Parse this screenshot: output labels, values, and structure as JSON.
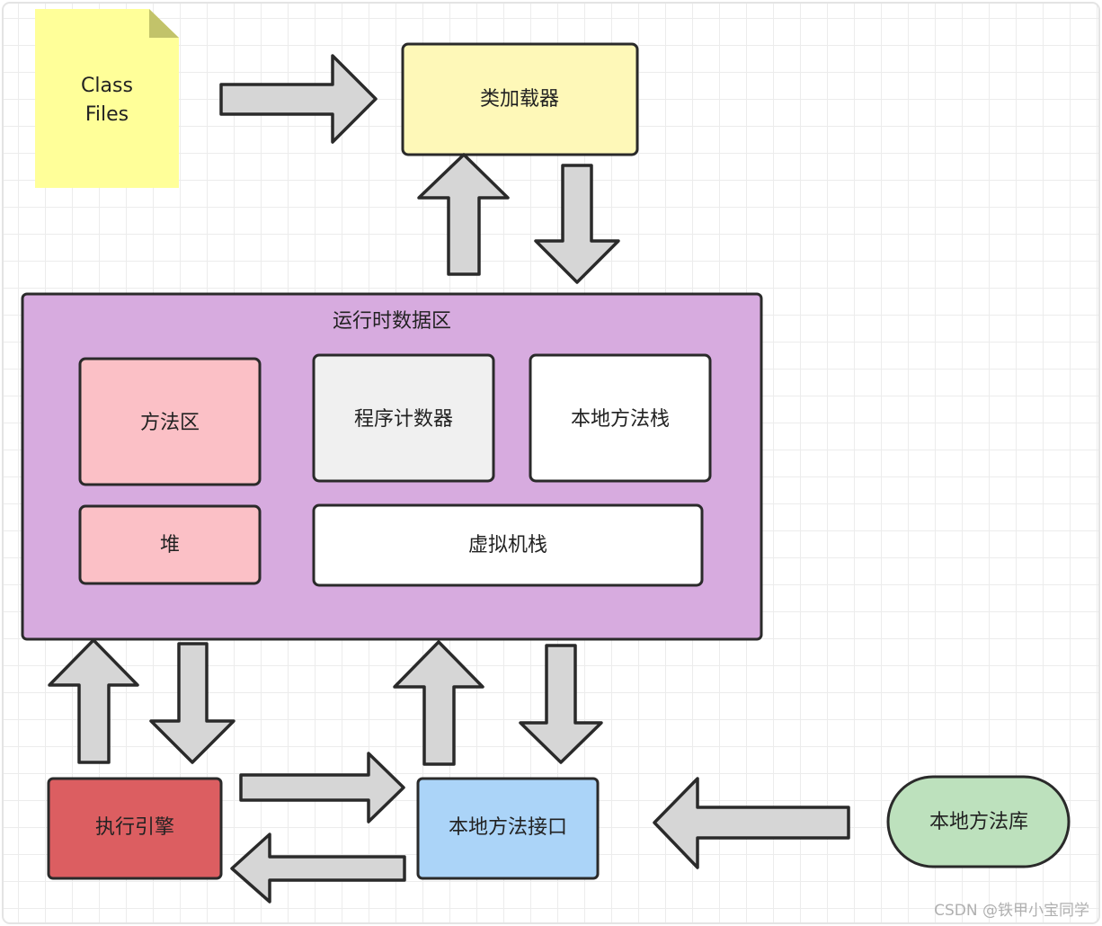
{
  "nodes": {
    "class_files": {
      "line1": "Class",
      "line2": "Files",
      "color": "#ffff99"
    },
    "class_loader": {
      "label": "类加载器",
      "color": "#fef8b8"
    },
    "runtime_data_area": {
      "label": "运行时数据区",
      "color": "#d7abdf"
    },
    "method_area": {
      "label": "方法区",
      "color": "#fbc0c6"
    },
    "program_counter": {
      "label": "程序计数器",
      "color": "#f0f0f0"
    },
    "native_method_stack": {
      "label": "本地方法栈",
      "color": "#ffffff"
    },
    "heap": {
      "label": "堆",
      "color": "#fbc0c6"
    },
    "vm_stack": {
      "label": "虚拟机栈",
      "color": "#ffffff"
    },
    "execution_engine": {
      "label": "执行引擎",
      "color": "#dc5e61"
    },
    "native_interface": {
      "label": "本地方法接口",
      "color": "#abd4f8"
    },
    "native_library": {
      "label": "本地方法库",
      "color": "#bde1bd"
    }
  },
  "edges": [
    {
      "from": "class_files",
      "to": "class_loader"
    },
    {
      "from": "runtime_data_area",
      "to": "class_loader"
    },
    {
      "from": "class_loader",
      "to": "runtime_data_area"
    },
    {
      "from": "execution_engine",
      "to": "runtime_data_area"
    },
    {
      "from": "runtime_data_area",
      "to": "execution_engine"
    },
    {
      "from": "native_interface",
      "to": "runtime_data_area"
    },
    {
      "from": "runtime_data_area",
      "to": "native_interface"
    },
    {
      "from": "execution_engine",
      "to": "native_interface"
    },
    {
      "from": "native_interface",
      "to": "execution_engine"
    },
    {
      "from": "native_library",
      "to": "native_interface"
    }
  ],
  "watermark": "CSDN @铁甲小宝同学"
}
